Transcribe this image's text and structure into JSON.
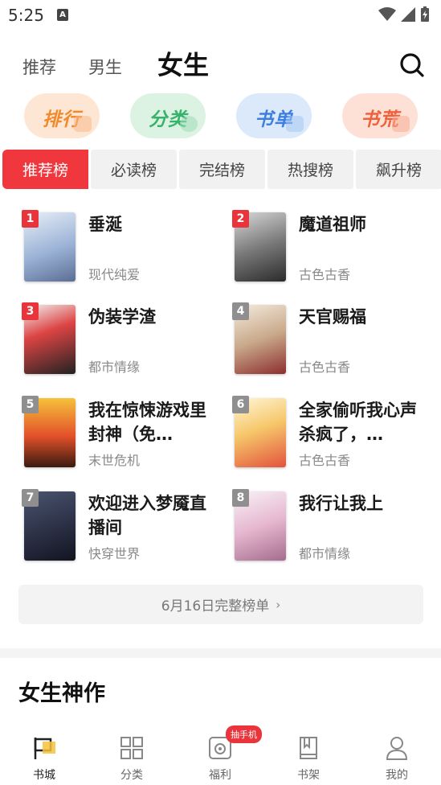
{
  "status": {
    "time": "5:25",
    "notif_icon": "A"
  },
  "nav": {
    "tabs": [
      "推荐",
      "男生",
      "女生"
    ],
    "active": "女生"
  },
  "quick": [
    {
      "label": "排行",
      "color": "#f08a2e",
      "bg": "#fde7d4"
    },
    {
      "label": "分类",
      "color": "#38b36b",
      "bg": "#dcf3e4"
    },
    {
      "label": "书单",
      "color": "#3c7fe0",
      "bg": "#dbe9fb"
    },
    {
      "label": "书荒",
      "color": "#f0603a",
      "bg": "#fde1d6"
    }
  ],
  "rank_tabs": [
    "推荐榜",
    "必读榜",
    "完结榜",
    "热搜榜",
    "飙升榜"
  ],
  "books": [
    {
      "rank": "1",
      "title": "垂涎",
      "genre": "现代纯爱"
    },
    {
      "rank": "2",
      "title": "魔道祖师",
      "genre": "古色古香"
    },
    {
      "rank": "3",
      "title": "伪装学渣",
      "genre": "都市情缘"
    },
    {
      "rank": "4",
      "title": "天官赐福",
      "genre": "古色古香"
    },
    {
      "rank": "5",
      "title": "我在惊悚游戏里封神（免…",
      "genre": "末世危机"
    },
    {
      "rank": "6",
      "title": "全家偷听我心声杀疯了，…",
      "genre": "古色古香"
    },
    {
      "rank": "7",
      "title": "欢迎进入梦魇直播间",
      "genre": "快穿世界"
    },
    {
      "rank": "8",
      "title": "我行让我上",
      "genre": "都市情缘"
    }
  ],
  "full_list": "6月16日完整榜单",
  "section": "女生神作",
  "tabbar": {
    "items": [
      "书城",
      "分类",
      "福利",
      "书架",
      "我的"
    ],
    "badge": "抽手机"
  }
}
